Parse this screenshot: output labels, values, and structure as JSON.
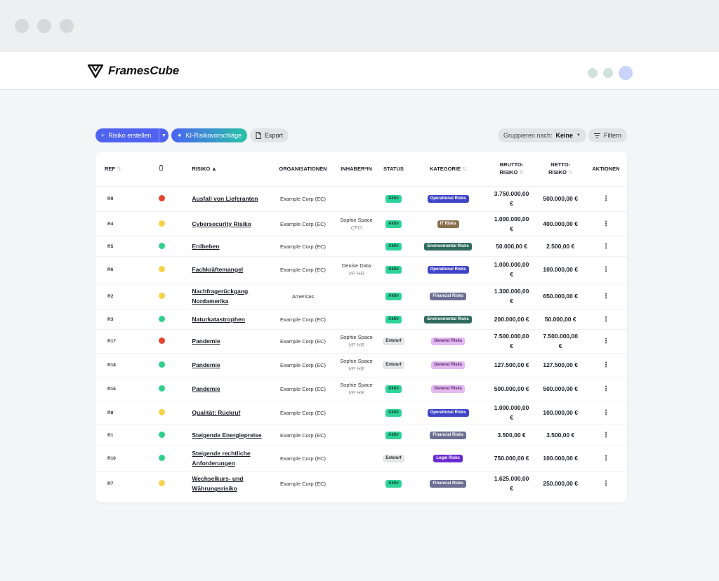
{
  "brand": {
    "name": "FramesCube"
  },
  "toolbar": {
    "create_label": "Risiko erstellen",
    "ai_label": "KI-Risikovorschläge",
    "export_label": "Export",
    "group_label": "Gruppieren nach:",
    "group_value": "Keine",
    "filter_label": "Filtern"
  },
  "table": {
    "headers": {
      "ref": "REF",
      "risk": "RISIKO",
      "orgs": "ORGANISATIONEN",
      "owner": "INHABER*IN",
      "status": "STATUS",
      "category": "KATEGORIE",
      "gross_1": "BRUTTO-",
      "gross_2": "RISIKO",
      "net_1": "NETTO-",
      "net_2": "RISIKO",
      "actions": "AKTIONEN"
    },
    "rows": [
      {
        "ref": "R9",
        "level": "red",
        "name_1": "Ausfall von Lieferanten",
        "name_2": "",
        "org": "Example Corp (EC)",
        "owner": "",
        "owner_role": "",
        "status": "Aktiv",
        "category": "Operational Risks",
        "gross_1": "3.750.000,00",
        "gross_2": "€",
        "net_1": "500.000,00 €",
        "net_2": ""
      },
      {
        "ref": "R4",
        "level": "yellow",
        "name_1": "Cybersecurity Risiko",
        "name_2": "",
        "org": "Example Corp (EC)",
        "owner": "Sophie Space",
        "owner_role": "CFO",
        "status": "Aktiv",
        "category": "IT Risks",
        "gross_1": "1.000.000,00",
        "gross_2": "€",
        "net_1": "400.000,00 €",
        "net_2": ""
      },
      {
        "ref": "R5",
        "level": "green",
        "name_1": "Erdbeben",
        "name_2": "",
        "org": "Example Corp (EC)",
        "owner": "",
        "owner_role": "",
        "status": "Aktiv",
        "category": "Environmental Risks",
        "gross_1": "50.000,00 €",
        "gross_2": "",
        "net_1": "2.500,00 €",
        "net_2": ""
      },
      {
        "ref": "R6",
        "level": "yellow",
        "name_1": "Fachkräftemangel",
        "name_2": "",
        "org": "Example Corp (EC)",
        "owner": "Denise Data",
        "owner_role": "VP HR",
        "status": "Aktiv",
        "category": "Operational Risks",
        "gross_1": "1.000.000,00",
        "gross_2": "€",
        "net_1": "100.000,00 €",
        "net_2": ""
      },
      {
        "ref": "R2",
        "level": "yellow",
        "name_1": "Nachfragerückgang",
        "name_2": "Nordamerika",
        "org": "Americas",
        "owner": "",
        "owner_role": "",
        "status": "Aktiv",
        "category": "Financial Risks",
        "gross_1": "1.300.000,00",
        "gross_2": "€",
        "net_1": "650.000,00 €",
        "net_2": ""
      },
      {
        "ref": "R3",
        "level": "green",
        "name_1": "Naturkatastrophen",
        "name_2": "",
        "org": "Example Corp (EC)",
        "owner": "",
        "owner_role": "",
        "status": "Aktiv",
        "category": "Environmental Risks",
        "gross_1": "200.000,00 €",
        "gross_2": "",
        "net_1": "50.000,00 €",
        "net_2": ""
      },
      {
        "ref": "R17",
        "level": "red",
        "name_1": "Pandemie",
        "name_2": "",
        "org": "Example Corp (EC)",
        "owner": "Sophie Space",
        "owner_role": "VP HR",
        "status": "Entwurf",
        "category": "General Risks",
        "gross_1": "7.500.000,00",
        "gross_2": "€",
        "net_1": "7.500.000,00",
        "net_2": "€"
      },
      {
        "ref": "R18",
        "level": "green",
        "name_1": "Pandemie",
        "name_2": "",
        "org": "Example Corp (EC)",
        "owner": "Sophie Space",
        "owner_role": "VP HR",
        "status": "Entwurf",
        "category": "General Risks",
        "gross_1": "127.500,00 €",
        "gross_2": "",
        "net_1": "127.500,00 €",
        "net_2": ""
      },
      {
        "ref": "R15",
        "level": "green",
        "name_1": "Pandemie",
        "name_2": "",
        "org": "Example Corp (EC)",
        "owner": "Sophie Space",
        "owner_role": "VP HR",
        "status": "Aktiv",
        "category": "General Risks",
        "gross_1": "500.000,00 €",
        "gross_2": "",
        "net_1": "500.000,00 €",
        "net_2": ""
      },
      {
        "ref": "R8",
        "level": "yellow",
        "name_1": "Qualität: Rückruf",
        "name_2": "",
        "org": "Example Corp (EC)",
        "owner": "",
        "owner_role": "",
        "status": "Aktiv",
        "category": "Operational Risks",
        "gross_1": "1.000.000,00",
        "gross_2": "€",
        "net_1": "100.000,00 €",
        "net_2": ""
      },
      {
        "ref": "R1",
        "level": "green",
        "name_1": "Steigende Energiepreise",
        "name_2": "",
        "org": "Example Corp (EC)",
        "owner": "",
        "owner_role": "",
        "status": "Aktiv",
        "category": "Financial Risks",
        "gross_1": "3.500,00 €",
        "gross_2": "",
        "net_1": "3.500,00 €",
        "net_2": ""
      },
      {
        "ref": "R10",
        "level": "green",
        "name_1": "Steigende rechtliche",
        "name_2": "Anforderungen",
        "org": "Example Corp (EC)",
        "owner": "",
        "owner_role": "",
        "status": "Entwurf",
        "category": "Legal Risks",
        "gross_1": "750.000,00 €",
        "gross_2": "",
        "net_1": "100.000,00 €",
        "net_2": ""
      },
      {
        "ref": "R7",
        "level": "yellow",
        "name_1": "Wechselkurs- und",
        "name_2": "Währungsrisiko",
        "org": "Example Corp (EC)",
        "owner": "",
        "owner_role": "",
        "status": "Aktiv",
        "category": "Financial Risks",
        "gross_1": "1.625.000,00",
        "gross_2": "€",
        "net_1": "250.000,00 €",
        "net_2": ""
      }
    ]
  },
  "colors": {
    "level": {
      "red": "#e8432f",
      "yellow": "#f4d24a",
      "green": "#2fcf8e"
    },
    "status": {
      "Aktiv": {
        "bg": "#2fd39a",
        "fg": "#0d3d2b"
      },
      "Entwurf": {
        "bg": "#e4e5e8",
        "fg": "#333333"
      }
    },
    "category": {
      "Operational Risks": {
        "bg": "#3f44c8",
        "fg": "#ffffff"
      },
      "IT Risks": {
        "bg": "#8a6f4d",
        "fg": "#ffffff"
      },
      "Environmental Risks": {
        "bg": "#2f6b5c",
        "fg": "#ffffff"
      },
      "Financial Risks": {
        "bg": "#6b6f91",
        "fg": "#ffffff"
      },
      "General Risks": {
        "bg": "#e4b8f0",
        "fg": "#5a2b6e"
      },
      "Legal Risks": {
        "bg": "#6a2ad2",
        "fg": "#ffffff"
      }
    }
  },
  "icons": {
    "plus": "plus-icon",
    "sparkle": "sparkle-icon",
    "doc": "document-icon",
    "filter": "filter-icon",
    "trash": "trash-icon",
    "menu": "more-vertical-icon"
  }
}
